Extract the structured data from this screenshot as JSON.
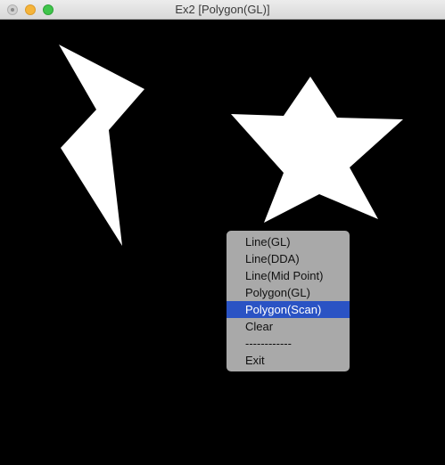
{
  "window": {
    "title": "Ex2  [Polygon(GL)]"
  },
  "canvas": {
    "background": "#000000",
    "shape_color": "#ffffff"
  },
  "context_menu": {
    "items": [
      {
        "label": "Line(GL)",
        "selected": false
      },
      {
        "label": "Line(DDA)",
        "selected": false
      },
      {
        "label": "Line(Mid Point)",
        "selected": false
      },
      {
        "label": "Polygon(GL)",
        "selected": false
      },
      {
        "label": "Polygon(Scan)",
        "selected": true
      },
      {
        "label": "Clear",
        "selected": false
      },
      {
        "label": "------------",
        "selected": false
      },
      {
        "label": "Exit",
        "selected": false
      }
    ],
    "selected_color": "#2a53c4"
  }
}
